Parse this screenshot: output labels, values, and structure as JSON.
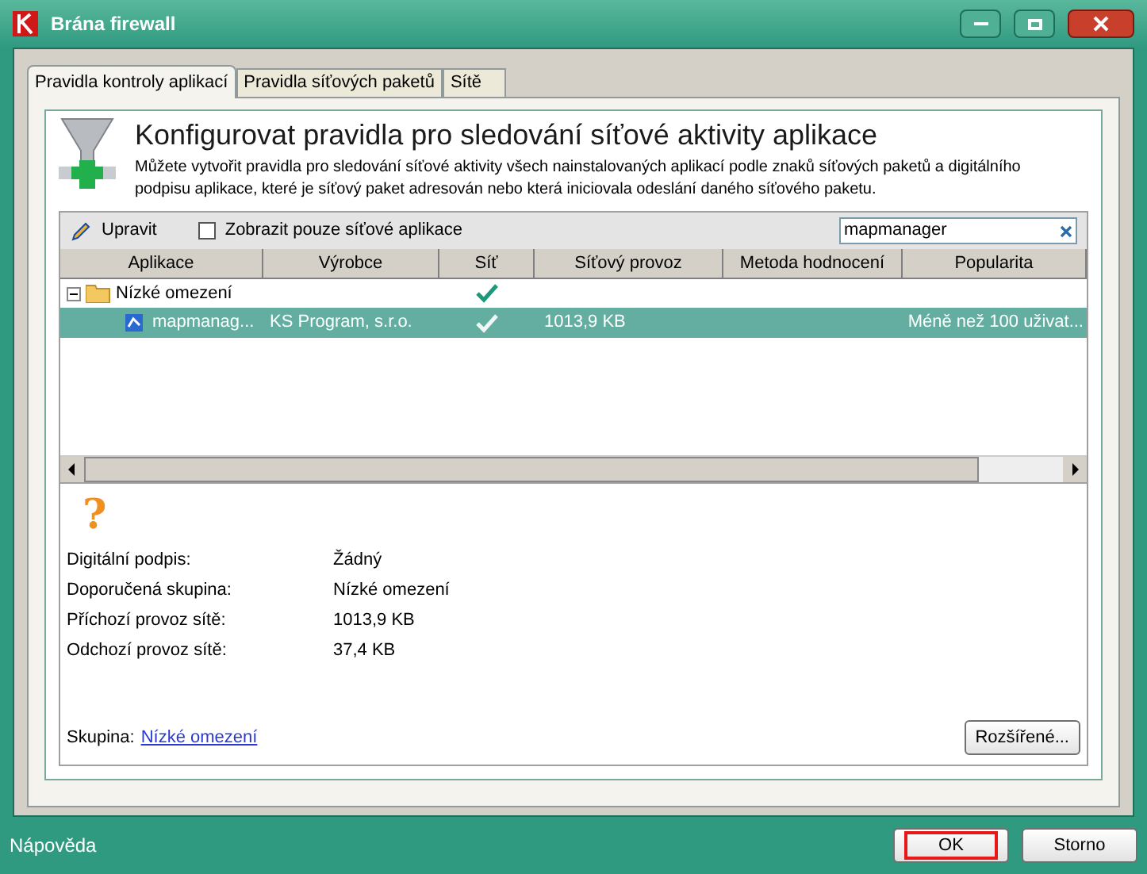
{
  "window": {
    "title": "Brána firewall"
  },
  "tabs": [
    {
      "label": "Pravidla kontroly aplikací",
      "selected": true
    },
    {
      "label": "Pravidla síťových paketů",
      "selected": false
    },
    {
      "label": "Sítě",
      "selected": false
    }
  ],
  "header": {
    "title": "Konfigurovat pravidla pro sledování síťové aktivity aplikace",
    "description": "Můžete vytvořit pravidla pro sledování síťové aktivity všech nainstalovaných aplikací podle znaků síťových paketů a digitálního podpisu aplikace, které je síťový paket adresován nebo která iniciovala odeslání daného síťového paketu."
  },
  "toolbar": {
    "edit_label": "Upravit",
    "filter": {
      "label": "Zobrazit pouze síťové aplikace",
      "checked": false
    },
    "search": {
      "value": "mapmanager"
    }
  },
  "table": {
    "columns": [
      "Aplikace",
      "Výrobce",
      "Síť",
      "Síťový provoz",
      "Metoda hodnocení",
      "Popularita"
    ],
    "rows": [
      {
        "name": "Nízké omezení",
        "expanded": true,
        "network": true,
        "children": [
          {
            "name": "mapmanag...",
            "vendor": "KS Program, s.r.o.",
            "network": true,
            "selected": true,
            "traffic": "1013,9 KB",
            "popularity": "Méně než 100 uživat..."
          }
        ]
      }
    ]
  },
  "details": {
    "icon": "?",
    "fields": [
      {
        "label": "Digitální podpis:",
        "value": "Žádný"
      },
      {
        "label": "Doporučená skupina:",
        "value": "Nízké omezení"
      },
      {
        "label": "Příchozí provoz sítě:",
        "value": "1013,9 KB"
      },
      {
        "label": "Odchozí provoz sítě:",
        "value": "37,4 KB"
      }
    ],
    "group_label": "Skupina:",
    "group_link": "Nízké omezení",
    "advanced_button": "Rozšířené..."
  },
  "footer": {
    "help_link": "Nápověda",
    "buttons": [
      {
        "label": "OK",
        "focused": true
      },
      {
        "label": "Storno",
        "focused": false
      }
    ]
  }
}
